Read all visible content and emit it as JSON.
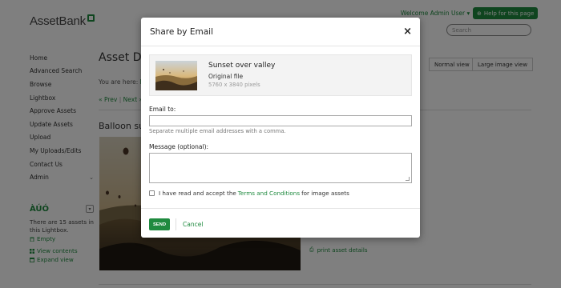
{
  "header": {
    "logo_text": "AssetBank",
    "welcome_text": "Welcome Admin User",
    "help_label": "Help for this page",
    "search_placeholder": "Search"
  },
  "sidebar": {
    "items": [
      {
        "label": "Home"
      },
      {
        "label": "Advanced Search"
      },
      {
        "label": "Browse"
      },
      {
        "label": "Lightbox"
      },
      {
        "label": "Approve Assets"
      },
      {
        "label": "Update Assets"
      },
      {
        "label": "Upload"
      },
      {
        "label": "My Uploads/Edits"
      },
      {
        "label": "Contact Us"
      },
      {
        "label": "Admin"
      }
    ]
  },
  "lightbox": {
    "name": "ÀÚÓ",
    "info": "There are 15 assets in this Lightbox.",
    "empty_label": "Empty",
    "view_contents_label": "View contents",
    "expand_view_label": "Expand view"
  },
  "main": {
    "title": "Asset De",
    "normal_view_label": "Normal view",
    "large_view_label": "Large image view",
    "breadcrumb_prefix": "You are here:",
    "breadcrumb_item": "F",
    "prev_label": "« Prev",
    "next_label": "Next »",
    "asset_heading": "Balloon su",
    "print_label": "print asset details"
  },
  "modal": {
    "title": "Share by Email",
    "close_label": "×",
    "asset": {
      "name": "Sunset over valley",
      "file": "Original file",
      "dimensions": "5760 x 3840 pixels"
    },
    "email_label": "Email to:",
    "email_value": "",
    "email_hint": "Separate multiple email addresses with a comma.",
    "message_label": "Message (optional):",
    "message_value": "",
    "terms_prefix": "I have read and accept the",
    "terms_link": "Terms and Conditions",
    "terms_suffix": "for image assets",
    "send_label": "SEND",
    "cancel_label": "Cancel"
  },
  "colors": {
    "brand_green": "#1f8a3f",
    "overlay": "rgba(0,0,0,0.5)"
  }
}
